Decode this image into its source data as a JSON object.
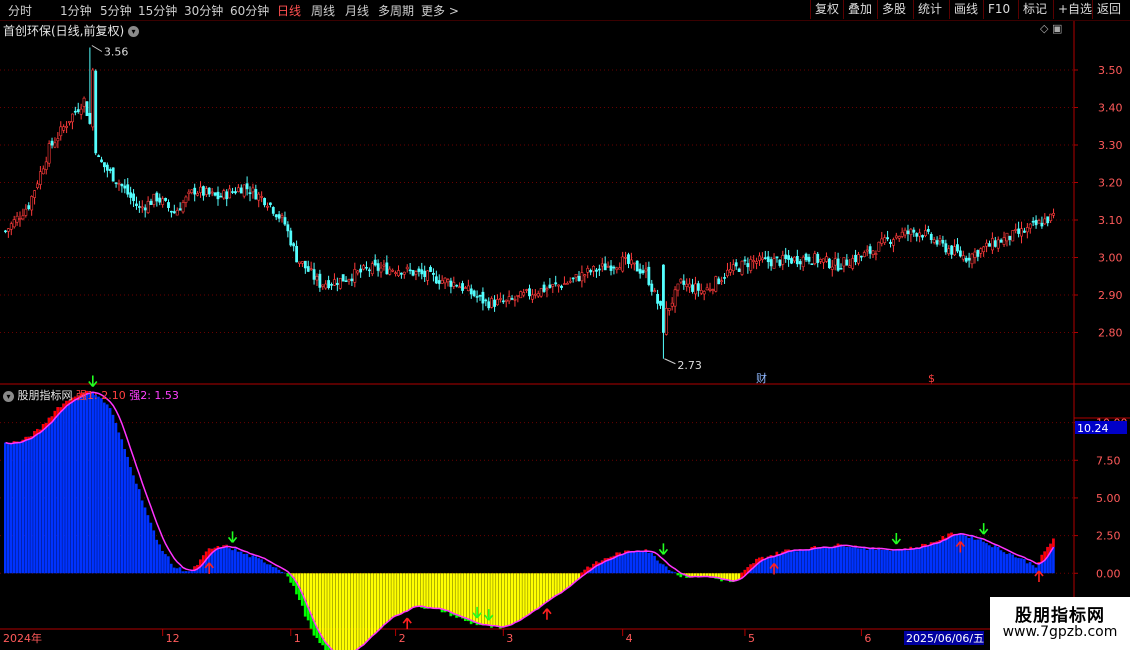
{
  "toolbar": {
    "periods": [
      "分时",
      "1分钟",
      "5分钟",
      "15分钟",
      "30分钟",
      "60分钟",
      "日线",
      "周线",
      "月线",
      "多周期",
      "更多 >"
    ],
    "active_period": "日线",
    "buttons": [
      "复权",
      "叠加",
      "多股",
      "统计",
      "画线",
      "F10",
      "标记",
      "+自选",
      "返回"
    ]
  },
  "main_chart": {
    "title": "首创环保(日线,前复权)",
    "price_axis": [
      "3.50",
      "3.40",
      "3.30",
      "3.20",
      "3.10",
      "3.00",
      "2.90",
      "2.80"
    ],
    "high_label": "3.56",
    "low_label": "2.73",
    "markers": {
      "cai": "财",
      "dollar": "$"
    }
  },
  "sub_chart": {
    "title": "股朋指标网",
    "qiang1_label": "强1: 2.10",
    "qiang2_label": "强2: 1.53",
    "current_value": "10.24",
    "value_axis": [
      "10.00",
      "7.50",
      "5.00",
      "2.50",
      "0.00"
    ]
  },
  "date_axis": {
    "year_label": "2024年",
    "month_labels": [
      "12",
      "1",
      "2",
      "3",
      "4",
      "5",
      "6"
    ],
    "current_date": "2025/06/06/五"
  },
  "watermark": {
    "line1": "股朋指标网",
    "line2": "www.7gpzb.com"
  },
  "colors": {
    "up": "#ff3b3b",
    "down": "#54ffff",
    "grid": "#6a0000",
    "bar_positive": "#0033ff",
    "bar_negative_main": "#ffff00",
    "bar_negative_edge": "#00ff00",
    "line_strong": "#ff33ff",
    "fill_strong": "#ff0000",
    "current_value_bg": "#0000c8"
  },
  "chart_data": {
    "type": "candlestick",
    "price_axis_ticks": [
      3.5,
      3.4,
      3.3,
      3.2,
      3.1,
      3.0,
      2.9,
      2.8
    ],
    "ylim": [
      2.7,
      3.58
    ],
    "price_high": 3.56,
    "price_low": 2.73,
    "x_months": [
      "2024年",
      "12",
      "1",
      "2",
      "3",
      "4",
      "5",
      "6"
    ],
    "close_anchors": [
      [
        0,
        3.07
      ],
      [
        8,
        3.14
      ],
      [
        15,
        3.29
      ],
      [
        22,
        3.37
      ],
      [
        27,
        3.42
      ],
      [
        32,
        3.26
      ],
      [
        40,
        3.19
      ],
      [
        46,
        3.13
      ],
      [
        52,
        3.16
      ],
      [
        58,
        3.12
      ],
      [
        65,
        3.18
      ],
      [
        73,
        3.16
      ],
      [
        82,
        3.19
      ],
      [
        90,
        3.15
      ],
      [
        96,
        3.09
      ],
      [
        100,
        3.0
      ],
      [
        108,
        2.93
      ],
      [
        115,
        2.94
      ],
      [
        125,
        2.97
      ],
      [
        135,
        2.97
      ],
      [
        145,
        2.95
      ],
      [
        155,
        2.93
      ],
      [
        165,
        2.88
      ],
      [
        172,
        2.88
      ],
      [
        182,
        2.91
      ],
      [
        192,
        2.93
      ],
      [
        200,
        2.96
      ],
      [
        212,
        2.99
      ],
      [
        220,
        2.96
      ],
      [
        226,
        2.84
      ],
      [
        232,
        2.93
      ],
      [
        240,
        2.91
      ],
      [
        248,
        2.96
      ],
      [
        256,
        2.99
      ],
      [
        266,
        2.99
      ],
      [
        276,
        3.0
      ],
      [
        286,
        2.98
      ],
      [
        296,
        3.01
      ],
      [
        306,
        3.06
      ],
      [
        314,
        3.07
      ],
      [
        322,
        3.03
      ],
      [
        330,
        3.0
      ],
      [
        340,
        3.04
      ],
      [
        350,
        3.07
      ],
      [
        360,
        3.11
      ]
    ],
    "indicator": {
      "axis_ticks": [
        10.0,
        7.5,
        5.0,
        2.5,
        0.0
      ],
      "ylim": [
        -3.5,
        11.5
      ],
      "current": 10.24,
      "qiang1": 2.1,
      "qiang2": 1.53,
      "anchors": [
        [
          0,
          8.6
        ],
        [
          6,
          8.8
        ],
        [
          12,
          9.6
        ],
        [
          18,
          11.0
        ],
        [
          24,
          11.8
        ],
        [
          30,
          12.1
        ],
        [
          36,
          11.0
        ],
        [
          44,
          6.6
        ],
        [
          52,
          2.2
        ],
        [
          58,
          0.4
        ],
        [
          64,
          0.1
        ],
        [
          70,
          1.6
        ],
        [
          76,
          1.8
        ],
        [
          82,
          1.3
        ],
        [
          90,
          0.7
        ],
        [
          96,
          0.1
        ],
        [
          100,
          -1.3
        ],
        [
          106,
          -4.2
        ],
        [
          112,
          -5.5
        ],
        [
          120,
          -5.0
        ],
        [
          130,
          -3.0
        ],
        [
          140,
          -2.1
        ],
        [
          150,
          -2.5
        ],
        [
          160,
          -3.3
        ],
        [
          170,
          -3.7
        ],
        [
          180,
          -2.4
        ],
        [
          190,
          -1.1
        ],
        [
          200,
          0.4
        ],
        [
          210,
          1.3
        ],
        [
          220,
          1.6
        ],
        [
          226,
          0.6
        ],
        [
          232,
          -0.2
        ],
        [
          240,
          -0.2
        ],
        [
          250,
          -0.6
        ],
        [
          258,
          0.9
        ],
        [
          268,
          1.5
        ],
        [
          278,
          1.7
        ],
        [
          288,
          1.9
        ],
        [
          298,
          1.6
        ],
        [
          310,
          1.6
        ],
        [
          318,
          2.0
        ],
        [
          326,
          2.7
        ],
        [
          334,
          2.3
        ],
        [
          344,
          1.4
        ],
        [
          354,
          0.5
        ],
        [
          360,
          2.3
        ]
      ]
    }
  }
}
